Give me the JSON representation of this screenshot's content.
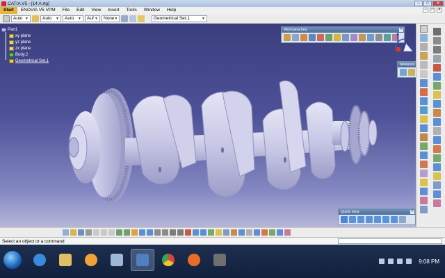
{
  "window": {
    "title": "CATIA V5 - [14 A.rtg]"
  },
  "menu": [
    "Start",
    "ENOVIA V5 VPM",
    "File",
    "Edit",
    "View",
    "Insert",
    "Tools",
    "Window",
    "Help"
  ],
  "property_toolbar": {
    "combos": [
      "Auto",
      "Auto",
      "Auto",
      "Auf",
      "None"
    ],
    "geometrical_set": "Geometrical Set.1"
  },
  "tree": {
    "root": "Part1",
    "planes": [
      "xy plane",
      "yz plane",
      "zx plane"
    ],
    "body": "Body.2",
    "geo_set": "Geometrical Set.1"
  },
  "toolbars": {
    "workbenches": "Workbenches",
    "measure": "Measure",
    "dy": "Dy",
    "quick_view": "Quick view"
  },
  "status": {
    "text": "Select an object or a command"
  },
  "taskbar": {
    "time": "9:08 PM"
  },
  "colors": {
    "viewport_top": "#3b3e7e",
    "viewport_bottom": "#b6b6da",
    "part_color": "#c8c8e6",
    "taskbar": "#1e2f4f"
  }
}
